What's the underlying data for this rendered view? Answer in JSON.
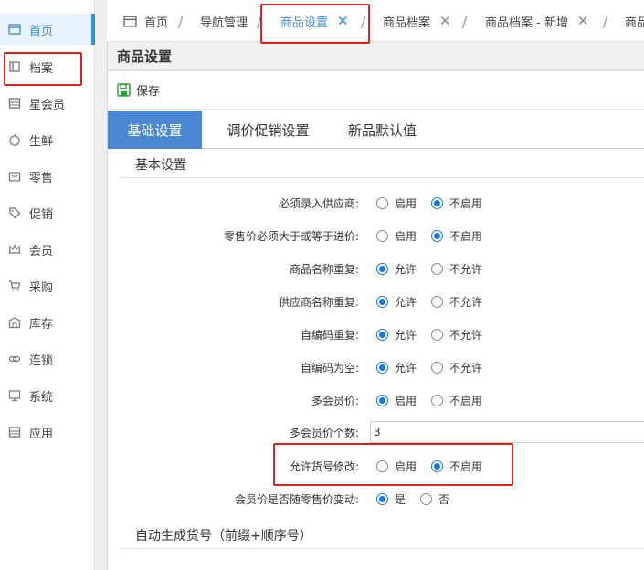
{
  "sidebar": {
    "items": [
      {
        "label": "首页",
        "icon": "home-icon"
      },
      {
        "label": "档案",
        "icon": "archive-icon"
      },
      {
        "label": "星会员",
        "icon": "star-member-icon"
      },
      {
        "label": "生鲜",
        "icon": "apple-icon"
      },
      {
        "label": "零售",
        "icon": "bag-icon"
      },
      {
        "label": "促销",
        "icon": "tag-icon"
      },
      {
        "label": "会员",
        "icon": "crown-icon"
      },
      {
        "label": "采购",
        "icon": "cart-icon"
      },
      {
        "label": "库存",
        "icon": "warehouse-icon"
      },
      {
        "label": "连锁",
        "icon": "link-icon"
      },
      {
        "label": "系统",
        "icon": "monitor-icon"
      },
      {
        "label": "应用",
        "icon": "app-icon"
      }
    ]
  },
  "tabs": [
    {
      "label": "首页"
    },
    {
      "label": "导航管理"
    },
    {
      "label": "商品设置"
    },
    {
      "label": "商品档案"
    },
    {
      "label": "商品档案 - 新增"
    },
    {
      "label": "商品"
    }
  ],
  "tab_close_glyph": "✕",
  "tab_separator": "/",
  "panel": {
    "title": "商品设置",
    "save_label": "保存"
  },
  "subtabs": [
    {
      "label": "基础设置"
    },
    {
      "label": "调价促销设置"
    },
    {
      "label": "新品默认值"
    }
  ],
  "section_basic": "基本设置",
  "settings": [
    {
      "label": "必须录入供应商:",
      "options": [
        "启用",
        "不启用"
      ],
      "selected": 1
    },
    {
      "label": "零售价必须大于或等于进价:",
      "options": [
        "启用",
        "不启用"
      ],
      "selected": 1
    },
    {
      "label": "商品名称重复:",
      "options": [
        "允许",
        "不允许"
      ],
      "selected": 0
    },
    {
      "label": "供应商名称重复:",
      "options": [
        "允许",
        "不允许"
      ],
      "selected": 0
    },
    {
      "label": "自编码重复:",
      "options": [
        "允许",
        "不允许"
      ],
      "selected": 0
    },
    {
      "label": "自编码为空:",
      "options": [
        "允许",
        "不允许"
      ],
      "selected": 0
    },
    {
      "label": "多会员价:",
      "options": [
        "启用",
        "不启用"
      ],
      "selected": 0
    }
  ],
  "member_price_count": {
    "label": "多会员价个数:",
    "value": "3"
  },
  "allow_code_edit": {
    "label": "允许货号修改:",
    "options": [
      "启用",
      "不启用"
    ],
    "selected": 1
  },
  "member_follow_retail": {
    "label": "会员价是否随零售价变动:",
    "options": [
      "是",
      "否"
    ],
    "selected": 0
  },
  "section_auto": "自动生成货号（前缀+顺序号）",
  "colors": {
    "accent": "#3c8dd8",
    "highlight": "#e02020",
    "subtab_active": "#4a86d2",
    "save_icon": "#2e9e3e"
  }
}
